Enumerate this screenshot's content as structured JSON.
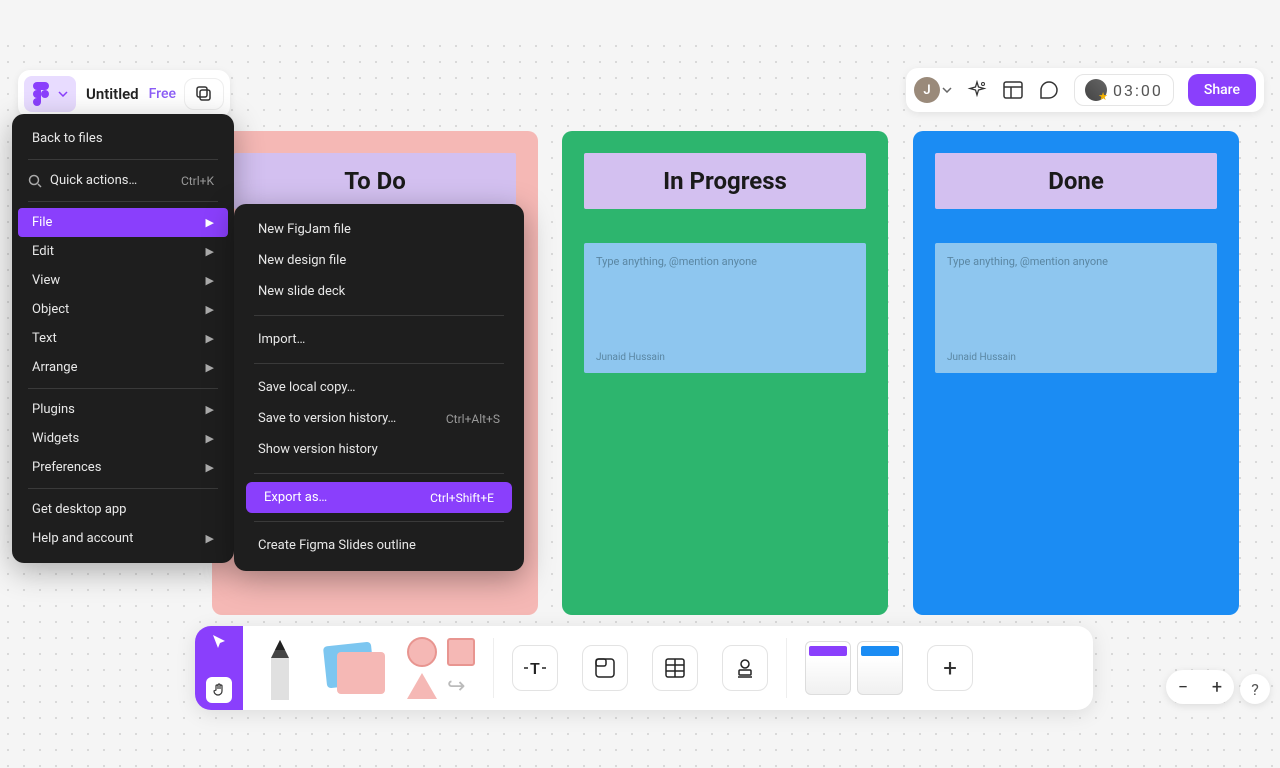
{
  "file": {
    "title": "Untitled",
    "badge": "Free"
  },
  "top_right": {
    "avatar_initial": "J",
    "timer": "03:00",
    "share": "Share"
  },
  "main_menu": {
    "back": "Back to files",
    "quick_actions": "Quick actions…",
    "quick_shortcut": "Ctrl+K",
    "file": "File",
    "edit": "Edit",
    "view": "View",
    "object": "Object",
    "text": "Text",
    "arrange": "Arrange",
    "plugins": "Plugins",
    "widgets": "Widgets",
    "preferences": "Preferences",
    "desktop": "Get desktop app",
    "help": "Help and account"
  },
  "file_submenu": {
    "new_figjam": "New FigJam file",
    "new_design": "New design file",
    "new_slide": "New slide deck",
    "import": "Import…",
    "save_local": "Save local copy…",
    "save_history": "Save to version history…",
    "save_history_shortcut": "Ctrl+Alt+S",
    "show_history": "Show version history",
    "export": "Export as…",
    "export_shortcut": "Ctrl+Shift+E",
    "create_slides": "Create Figma Slides outline"
  },
  "columns": {
    "todo": "To Do",
    "progress": "In Progress",
    "done": "Done"
  },
  "sticky": {
    "placeholder": "Type anything, @mention anyone",
    "author": "Junaid Hussain"
  },
  "colors": {
    "purple": "#8a3ffc",
    "pink": "#f5b8b5",
    "green": "#2db56e",
    "blue": "#1b8cf3",
    "lilac": "#d3c0f0"
  }
}
